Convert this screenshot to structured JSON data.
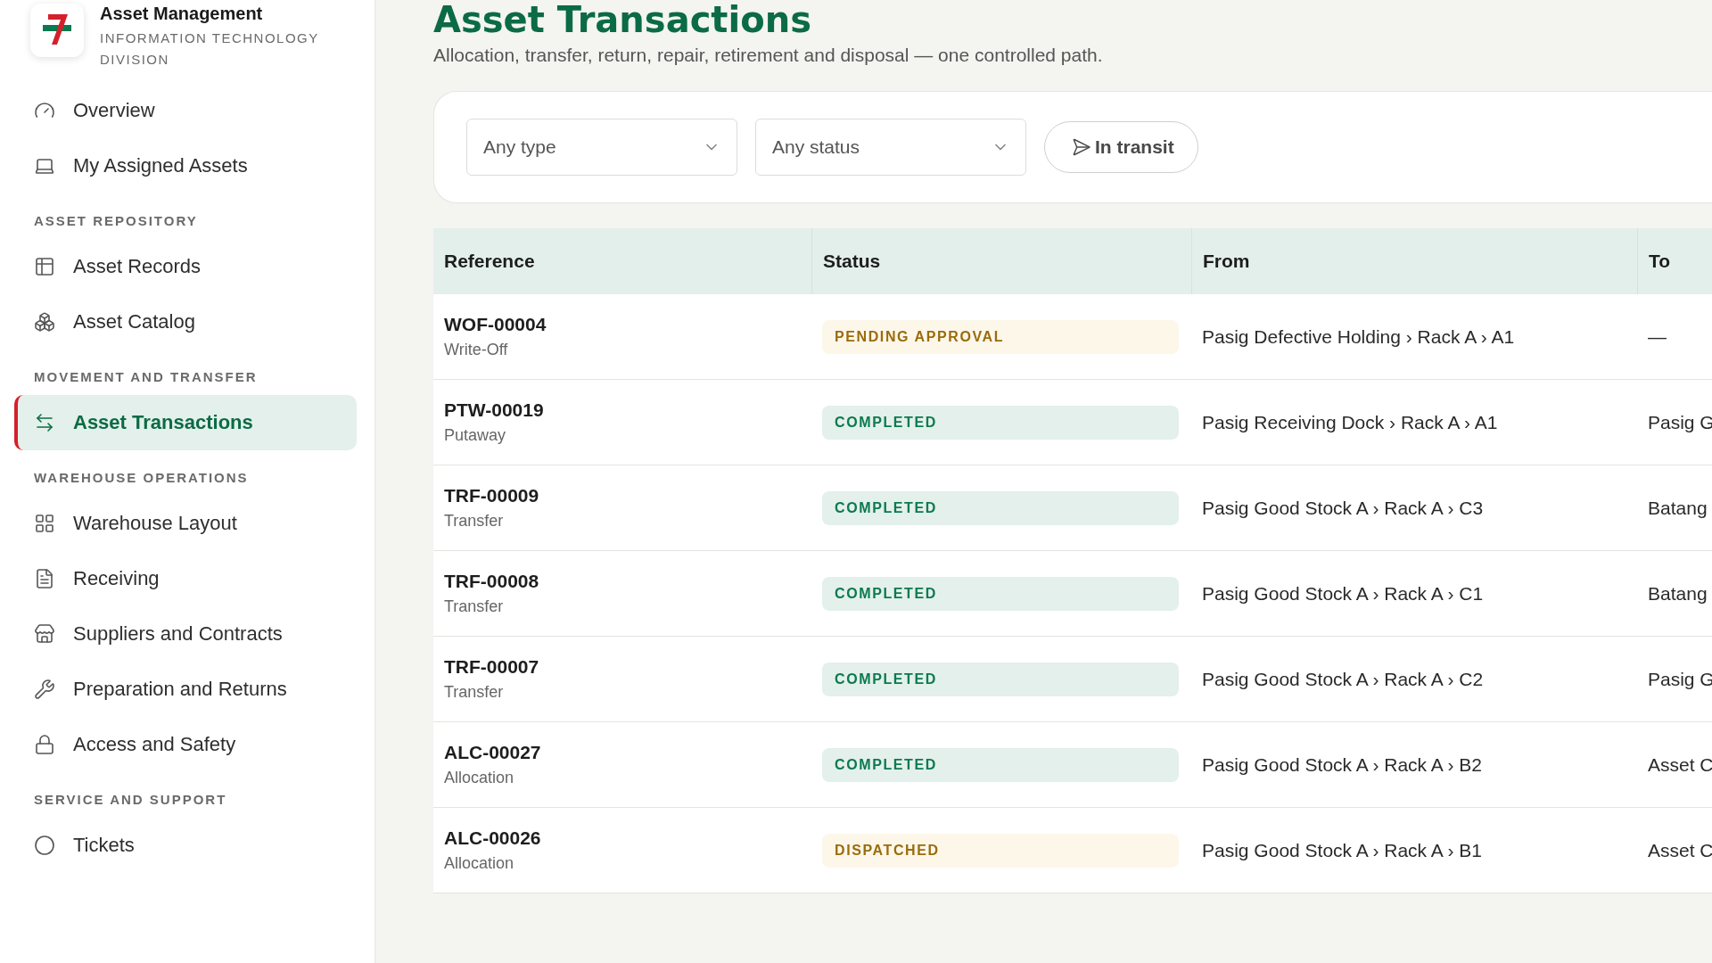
{
  "sidebar": {
    "app_title": "Asset Management",
    "division": "INFORMATION TECHNOLOGY DIVISION",
    "sections": [
      {
        "items": [
          {
            "label": "Overview",
            "kind": "gauge",
            "selected": false
          },
          {
            "label": "My Assigned Assets",
            "kind": "laptop",
            "selected": false
          }
        ]
      },
      {
        "heading": "ASSET REPOSITORY",
        "items": [
          {
            "label": "Asset Records",
            "kind": "records",
            "selected": false
          },
          {
            "label": "Asset Catalog",
            "kind": "catalog",
            "selected": false
          }
        ]
      },
      {
        "heading": "MOVEMENT AND TRANSFER",
        "items": [
          {
            "label": "Asset Transactions",
            "kind": "transfer",
            "selected": true
          }
        ]
      },
      {
        "heading": "WAREHOUSE OPERATIONS",
        "items": [
          {
            "label": "Warehouse Layout",
            "kind": "grid",
            "selected": false
          },
          {
            "label": "Receiving",
            "kind": "file",
            "selected": false
          },
          {
            "label": "Suppliers and Contracts",
            "kind": "store",
            "selected": false
          },
          {
            "label": "Preparation and Returns",
            "kind": "wrench",
            "selected": false
          },
          {
            "label": "Access and Safety",
            "kind": "lock",
            "selected": false
          }
        ]
      },
      {
        "heading": "SERVICE AND SUPPORT",
        "items": [
          {
            "label": "Tickets",
            "kind": "circle",
            "selected": false
          }
        ]
      }
    ]
  },
  "page": {
    "title": "Asset Transactions",
    "subtitle": "Allocation, transfer, return, repair, retirement and disposal — one controlled path."
  },
  "filters": {
    "type_select": "Any type",
    "status_select": "Any status",
    "in_transit": {
      "label": "In transit",
      "selected": false
    }
  },
  "table": {
    "columns": [
      "Reference",
      "Status",
      "From",
      "To"
    ],
    "rows": [
      {
        "reference": "WOF-00004",
        "type": "Write-Off",
        "status": "PENDING APPROVAL",
        "kind": "pending",
        "from": "Pasig Defective Holding › Rack A › A1",
        "to": "—"
      },
      {
        "reference": "PTW-00019",
        "type": "Putaway",
        "status": "COMPLETED",
        "kind": "completed",
        "from": "Pasig Receiving Dock › Rack A › A1",
        "to": "Pasig G"
      },
      {
        "reference": "TRF-00009",
        "type": "Transfer",
        "status": "COMPLETED",
        "kind": "completed",
        "from": "Pasig Good Stock A › Rack A › C3",
        "to": "Batang"
      },
      {
        "reference": "TRF-00008",
        "type": "Transfer",
        "status": "COMPLETED",
        "kind": "completed",
        "from": "Pasig Good Stock A › Rack A › C1",
        "to": "Batang"
      },
      {
        "reference": "TRF-00007",
        "type": "Transfer",
        "status": "COMPLETED",
        "kind": "completed",
        "from": "Pasig Good Stock A › Rack A › C2",
        "to": "Pasig G"
      },
      {
        "reference": "ALC-00027",
        "type": "Allocation",
        "status": "COMPLETED",
        "kind": "completed",
        "from": "Pasig Good Stock A › Rack A › B2",
        "to": "Asset C"
      },
      {
        "reference": "ALC-00026",
        "type": "Allocation",
        "status": "DISPATCHED",
        "kind": "dispatched",
        "from": "Pasig Good Stock A › Rack A › B1",
        "to": "Asset C"
      }
    ]
  }
}
